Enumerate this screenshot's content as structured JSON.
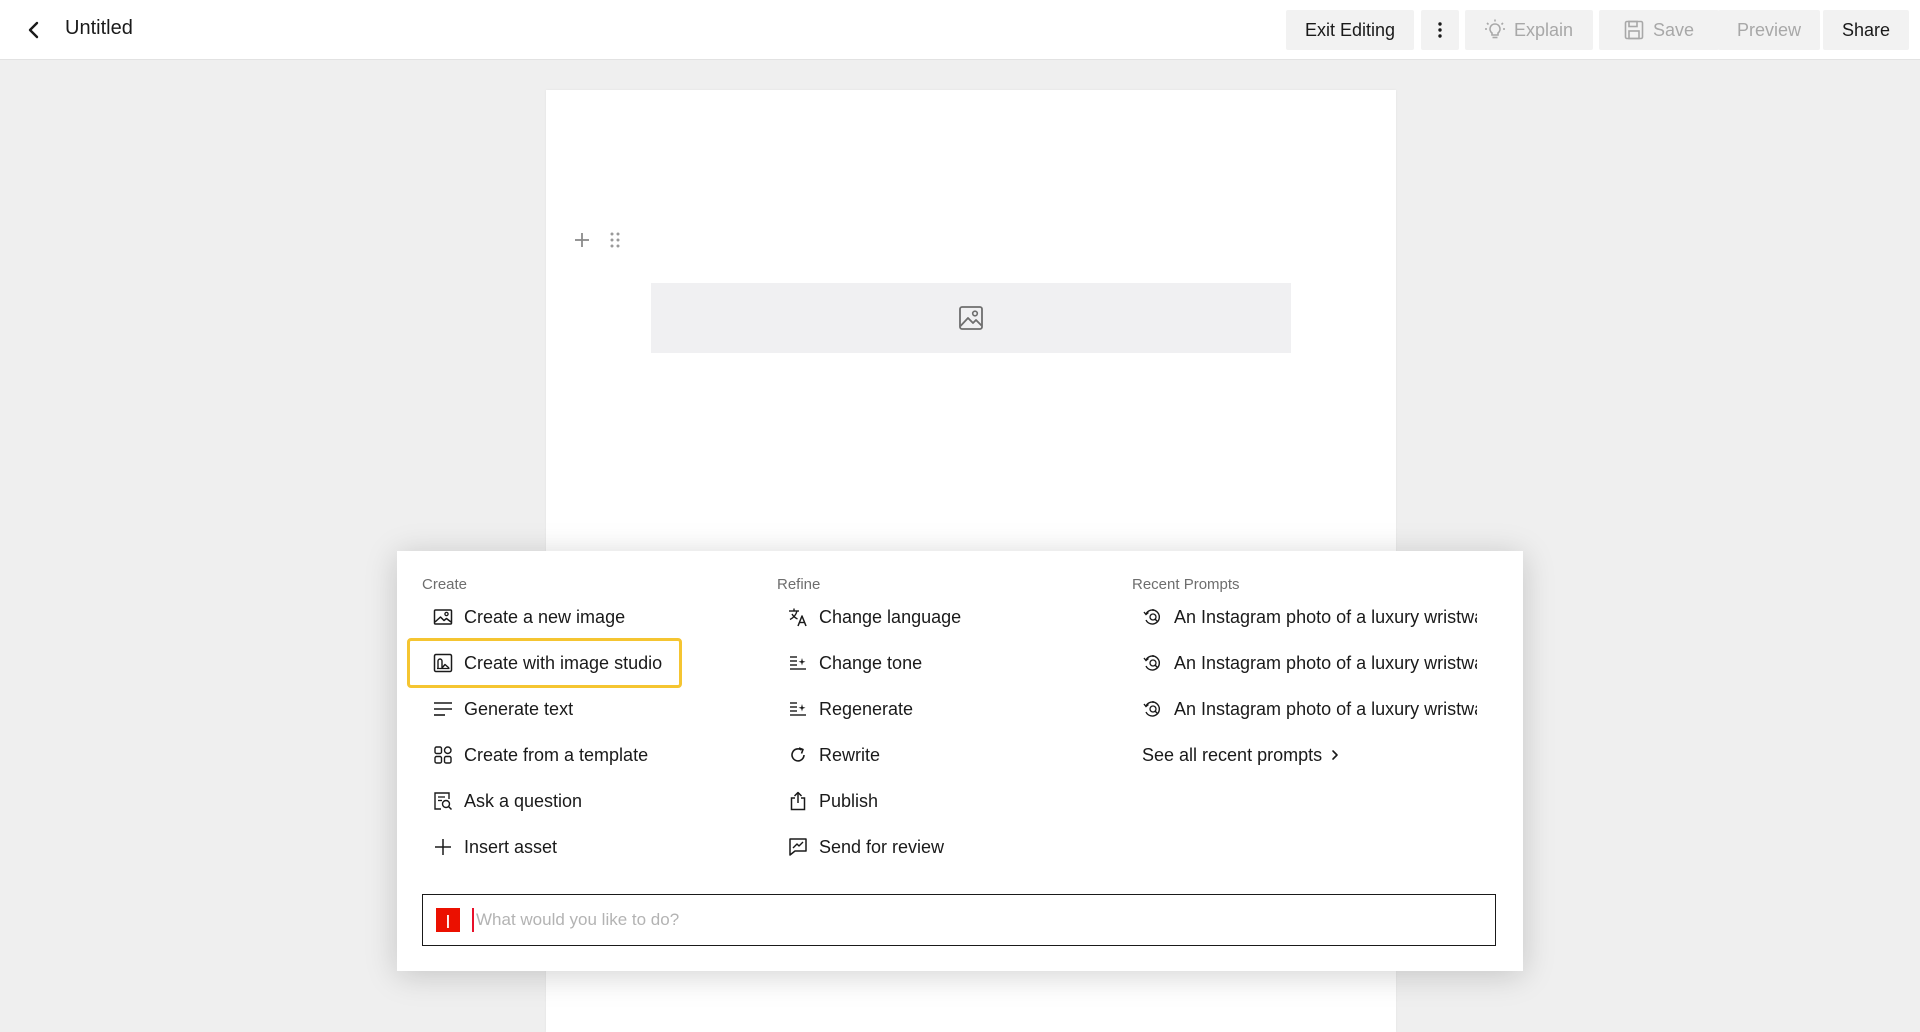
{
  "topbar": {
    "title": "Untitled",
    "exit_editing": "Exit Editing",
    "explain": "Explain",
    "save": "Save",
    "preview": "Preview",
    "share": "Share",
    "back_icon": "chevron-left-icon",
    "more_icon": "kebab-vertical-icon"
  },
  "canvas": {
    "add_icon": "plus-icon",
    "drag_icon": "drag-handle-icon",
    "image_icon": "image-icon"
  },
  "ai_menu": {
    "create": {
      "heading": "Create",
      "items": [
        {
          "label": "Create a new image",
          "icon": "image-icon"
        },
        {
          "label": "Create with image studio",
          "icon": "image-studio-icon"
        },
        {
          "label": "Generate text",
          "icon": "text-lines-icon"
        },
        {
          "label": "Create from a template",
          "icon": "template-grid-icon"
        },
        {
          "label": "Ask a question",
          "icon": "ask-question-icon"
        },
        {
          "label": "Insert asset",
          "icon": "plus-icon"
        }
      ]
    },
    "refine": {
      "heading": "Refine",
      "items": [
        {
          "label": "Change language",
          "icon": "translate-icon"
        },
        {
          "label": "Change tone",
          "icon": "text-sparkle-icon"
        },
        {
          "label": "Regenerate",
          "icon": "text-sparkle-icon"
        },
        {
          "label": "Rewrite",
          "icon": "refresh-icon"
        },
        {
          "label": "Publish",
          "icon": "share-upload-icon"
        },
        {
          "label": "Send for review",
          "icon": "review-icon"
        }
      ]
    },
    "recent": {
      "heading": "Recent Prompts",
      "items": [
        {
          "label": "An Instagram photo of a luxury wristwa",
          "icon": "history-search-icon"
        },
        {
          "label": "An Instagram photo of a luxury wristwa",
          "icon": "history-search-icon"
        },
        {
          "label": "An Instagram photo of a luxury wristwa",
          "icon": "history-search-icon"
        }
      ],
      "see_all": "See all recent prompts"
    },
    "prompt": {
      "placeholder": "What would you like to do?",
      "value": ""
    },
    "highlight_color": "#f5c531",
    "brand_color": "#eb1000"
  }
}
